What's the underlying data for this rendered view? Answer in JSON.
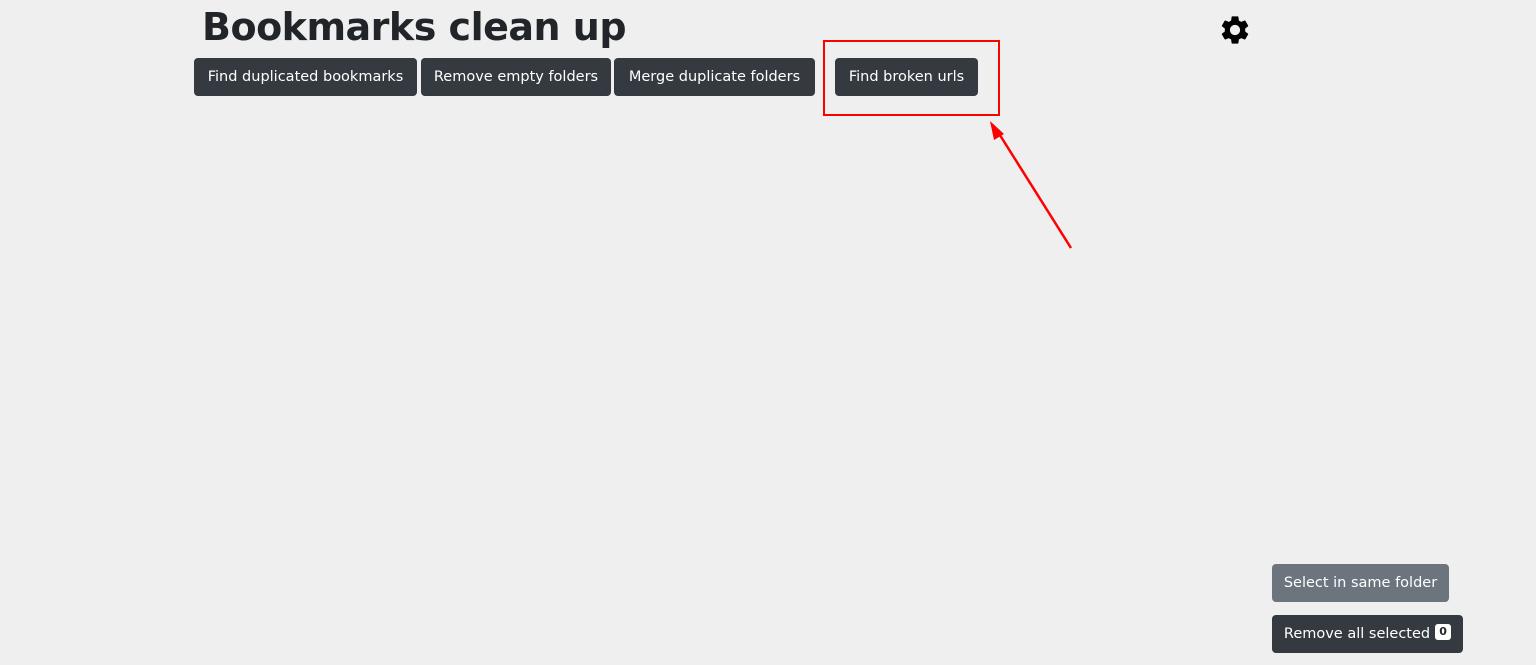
{
  "header": {
    "title": "Bookmarks clean up",
    "settings_icon": "gear-icon"
  },
  "toolbar": {
    "find_duplicated": "Find duplicated bookmarks",
    "remove_empty": "Remove empty folders",
    "merge_duplicate": "Merge duplicate folders",
    "find_broken": "Find broken urls"
  },
  "annotation": {
    "highlight_color": "#ff0000",
    "arrow_color": "#ff0000"
  },
  "footer": {
    "select_same_folder": "Select in same folder",
    "remove_all_selected": "Remove all selected",
    "selected_count": "0"
  },
  "colors": {
    "background": "#efefef",
    "dark_button": "#343a40",
    "gray_button": "#6c757d"
  }
}
